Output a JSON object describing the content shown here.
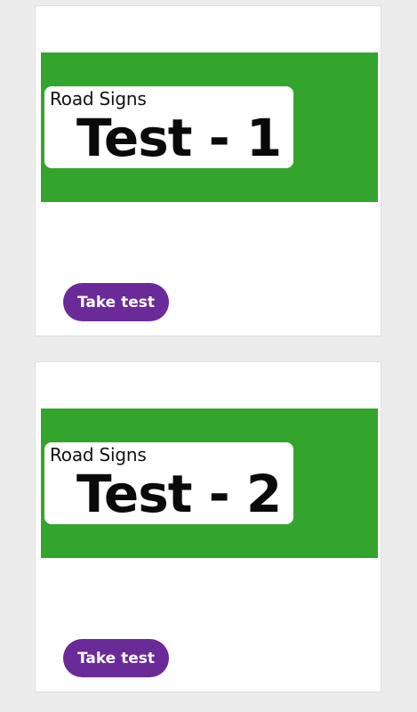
{
  "tests": [
    {
      "subtitle": "Road Signs",
      "title": "Test - 1",
      "button_label": "Take test"
    },
    {
      "subtitle": "Road Signs",
      "title": "Test - 2",
      "button_label": "Take test"
    }
  ],
  "colors": {
    "page_background": "#ececec",
    "banner_green": "#34a52c",
    "button_purple": "#6a2a98"
  }
}
